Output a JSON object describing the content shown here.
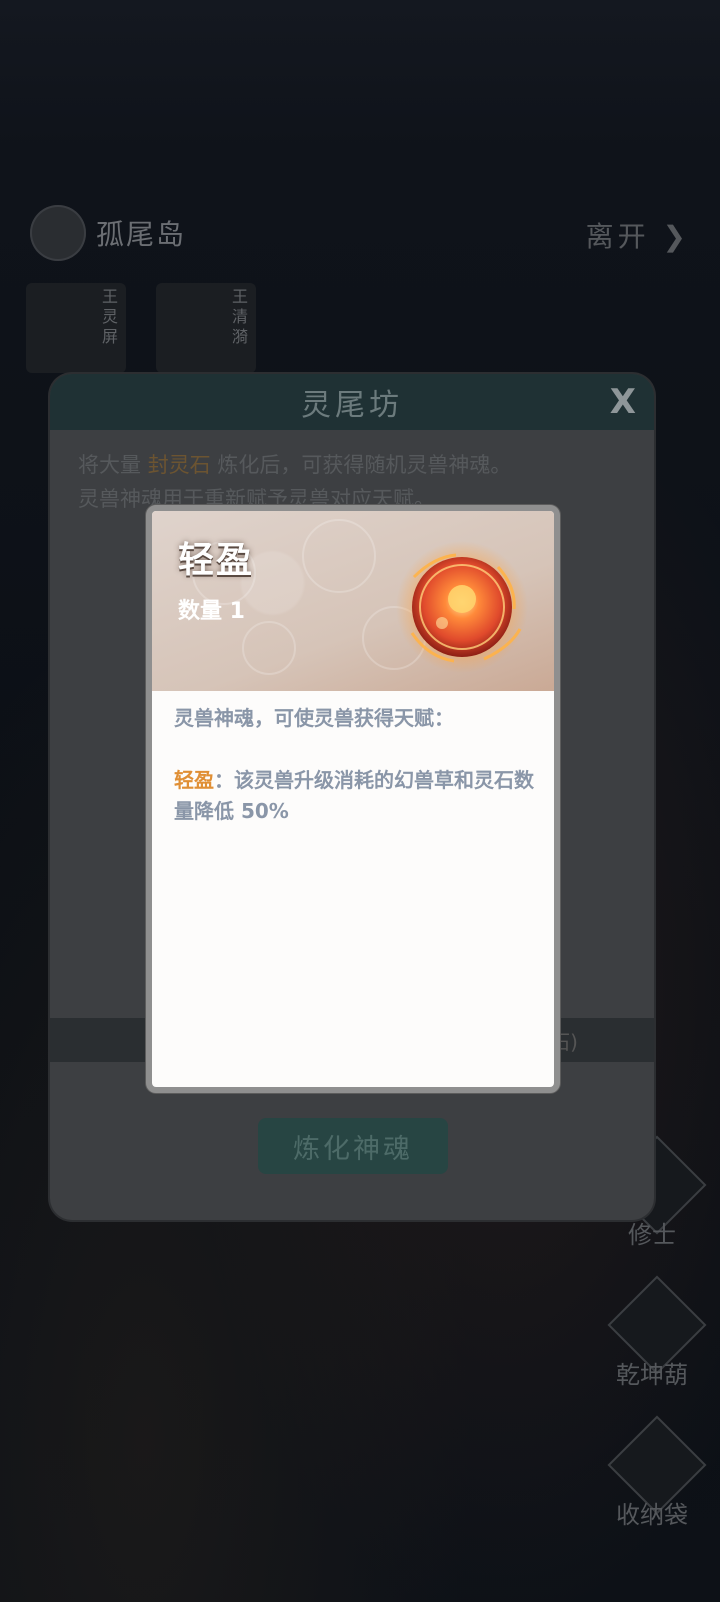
{
  "background": {
    "island_name": "孤尾岛",
    "leave_label": "离开",
    "portraits": [
      {
        "tag": "王灵屏"
      },
      {
        "tag": "王清漪"
      }
    ],
    "side_buttons": [
      "修士",
      "乾坤葫",
      "收纳袋"
    ]
  },
  "dialog": {
    "title": "灵尾坊",
    "close_label": "X",
    "desc_line1_prefix": "将大量",
    "desc_line1_highlight": "封灵石",
    "desc_line1_suffix": "炼化后，可获得随机灵兽神魂。",
    "desc_line2": "灵兽神魂用于重新赋予灵兽对应天赋。",
    "band_text": "石)",
    "action_button": "炼化神魂"
  },
  "popup": {
    "item_name": "轻盈",
    "quantity_text": "数量 1",
    "description": "灵兽神魂，可使灵兽获得天赋：",
    "talent_name": "轻盈",
    "talent_text": "：该灵兽升级消耗的幻兽草和灵石数量降低 50%"
  },
  "colors": {
    "highlight_orange": "#e08f35",
    "body_text": "#8a96a8",
    "popup_border": "#8f8f8f"
  }
}
